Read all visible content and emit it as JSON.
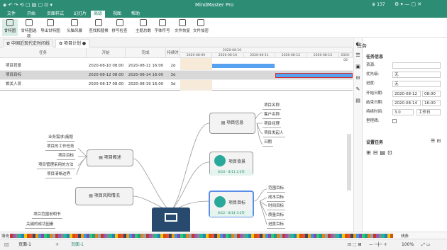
{
  "app": {
    "title": "MindMaster Pro",
    "vip_label": "137",
    "accent": "#2c8c74"
  },
  "menu": [
    "文件",
    "开始",
    "页面样式",
    "幻灯片",
    "高级",
    "视图",
    "帮助"
  ],
  "menu_active": "高级",
  "ribbon": [
    "甘特图",
    "甘特图选项",
    "导出甘特图",
    "头脑风暴",
    "查找和替换",
    "拼写检查",
    "主题总数",
    "字体符号",
    "文件恢复",
    "文件加密"
  ],
  "doc_tabs": [
    "中国近现代史时间线",
    "项目计划"
  ],
  "gantt": {
    "headers": [
      "任务",
      "开始",
      "完成",
      "持续时",
      "2020-08-10"
    ],
    "dates": [
      "2020-08-09",
      "2020-08-10",
      "2020-08-11",
      "2020-08-12",
      "2020-08-13",
      "2020-08"
    ],
    "rows": [
      {
        "task": "项目背景",
        "start": "2020-08-10 08:00",
        "end": "2020-08-11 16:00",
        "dur": "2d"
      },
      {
        "task": "项目目标",
        "start": "2020-08-12 08:00",
        "end": "2020-08-14 16:00",
        "dur": "3d"
      },
      {
        "task": "相关人员",
        "start": "2020-08-17 08:00",
        "end": "2020-08-19 16:00",
        "dur": "3d"
      }
    ]
  },
  "mindmap": {
    "overview": "项目概述",
    "overview_subs": [
      "业务需求/痛题",
      "项目的工作任务",
      "项目目标",
      "项目管理采用的方法",
      "项目清晰边界"
    ],
    "risk": "项目风险情况",
    "risk_subs": [
      "项目范围说明书",
      "关键的成功因素"
    ],
    "info": "项目信息",
    "info_subs": [
      "项目名称",
      "客户名称",
      "项目经理",
      "项目发起人",
      "日期"
    ],
    "bg": "项目背景",
    "bg_meta": "8/10 - 8/11  2.0天",
    "goal": "项目目标",
    "goal_meta": "8/12 - 8/14  3.0天",
    "goal_subs": [
      "范围目标",
      "成本目标",
      "时间目标",
      "质量目标",
      "进度目标"
    ]
  },
  "panel": {
    "title": "任务",
    "section": "任务信息",
    "labels": [
      "资源:",
      "优先级:",
      "进度:",
      "开始日期:",
      "结束日期:",
      "持续时间:",
      "里程碑:"
    ],
    "priority": "无",
    "progress": "无",
    "start_date": "2020-08-12",
    "start_time": "08:00",
    "end_date": "2020-08-14",
    "end_time": "16:00",
    "duration": "3.0",
    "duration_unit": "工作日",
    "settings": "设置任务"
  },
  "status": {
    "page": "页面-1",
    "page_tab": "页面-1",
    "zoom": "100%",
    "fill": "填充",
    "line": "线条"
  }
}
